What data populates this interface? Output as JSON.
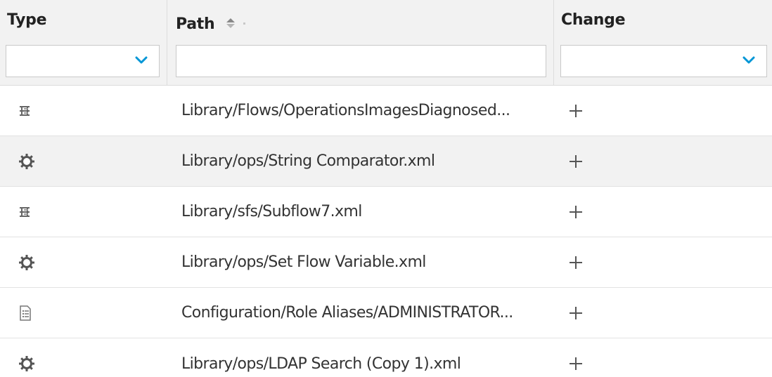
{
  "columns": {
    "type": {
      "label": "Type"
    },
    "path": {
      "label": "Path"
    },
    "change": {
      "label": "Change"
    }
  },
  "filters": {
    "type_value": "",
    "path_value": "",
    "change_value": ""
  },
  "rows": [
    {
      "type_icon": "flow-icon",
      "path": "Library/Flows/OperationsImagesDiagnosed...",
      "change_icon": "plus-icon"
    },
    {
      "type_icon": "gear-icon",
      "path": "Library/ops/String Comparator.xml",
      "change_icon": "plus-icon"
    },
    {
      "type_icon": "flow-icon",
      "path": "Library/sfs/Subflow7.xml",
      "change_icon": "plus-icon"
    },
    {
      "type_icon": "gear-icon",
      "path": "Library/ops/Set Flow Variable.xml",
      "change_icon": "plus-icon"
    },
    {
      "type_icon": "document-icon",
      "path": "Configuration/Role Aliases/ADMINISTRATOR...",
      "change_icon": "plus-icon"
    },
    {
      "type_icon": "gear-icon",
      "path": "Library/ops/LDAP Search (Copy 1).xml",
      "change_icon": "plus-icon"
    }
  ],
  "colors": {
    "header_bg": "#f2f2f2",
    "alt_row_bg": "#f2f2f2",
    "chevron": "#0096d6"
  }
}
